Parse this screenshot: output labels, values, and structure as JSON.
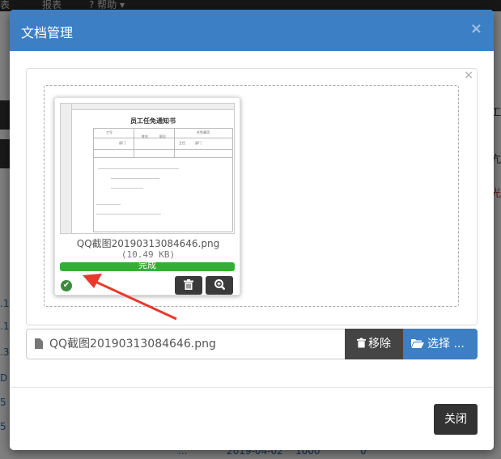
{
  "background": {
    "menus": [
      "表",
      "报表",
      "? 帮助 ▾"
    ],
    "left_links": [
      ".1",
      ".1",
      ".3",
      "D",
      "5",
      "5",
      "0"
    ],
    "right_chars": [
      "工",
      "亢",
      "光"
    ],
    "bottom_row": [
      "...",
      "2019-04-02",
      "1000",
      "0"
    ]
  },
  "modal": {
    "title": "文档管理",
    "close_glyph": "×",
    "preview": {
      "box_close_glyph": "×",
      "file_name": "QQ截图20190313084646.png",
      "file_size": "(10.49 KB)",
      "progress_label": "完成",
      "progress_percent": 100,
      "thumbnail": {
        "title": "员工任免通知书",
        "cells": [
          "工号",
          "姓名",
          "职位",
          "部门",
          "主任",
          "部门",
          "任免事项"
        ]
      }
    },
    "file_input": {
      "caption": "QQ截图20190313084646.png",
      "remove_label": "移除",
      "select_label": "选择 ..."
    },
    "footer": {
      "close_label": "关闭"
    }
  },
  "colors": {
    "header": "#3c7fc4",
    "progress": "#33b033",
    "annotation_arrow": "#e8392e"
  }
}
